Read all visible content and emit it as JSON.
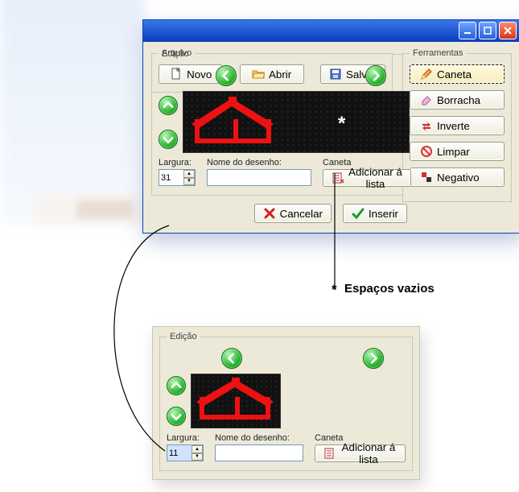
{
  "window": {
    "groups": {
      "arquivo": {
        "label": "Arquivo",
        "novo": "Novo",
        "abrir": "Abrir",
        "salvar": "Salvar"
      },
      "ferramentas": {
        "label": "Ferramentas",
        "caneta": "Caneta",
        "borracha": "Borracha",
        "inverte": "Inverte",
        "limpar": "Limpar",
        "negativo": "Negativo"
      },
      "edicao": {
        "label": "Edição",
        "largura_label": "Largura:",
        "largura_value": "31",
        "nome_label": "Nome do desenho:",
        "nome_value": "",
        "caneta_label": "Caneta",
        "adicionar": "Adicionar á lista"
      }
    },
    "actions": {
      "cancelar": "Cancelar",
      "inserir": "Inserir"
    }
  },
  "panel2": {
    "edicao": {
      "label": "Edição",
      "largura_label": "Largura:",
      "largura_value": "11",
      "nome_label": "Nome do desenho:",
      "nome_value": "",
      "caneta_label": "Caneta",
      "adicionar": "Adicionar á lista"
    }
  },
  "annotation": {
    "star_marker": "*",
    "espacos": "Espaços vazios"
  },
  "icons": {
    "caneta": "pen-icon",
    "borracha": "eraser-icon",
    "inverte": "invert-icon",
    "limpar": "clear-icon",
    "negativo": "negative-icon",
    "novo": "new-icon",
    "abrir": "open-icon",
    "salvar": "save-icon",
    "adicionar": "addlist-icon",
    "cancelar": "cancel-icon",
    "inserir": "check-icon"
  },
  "chart_data": null
}
